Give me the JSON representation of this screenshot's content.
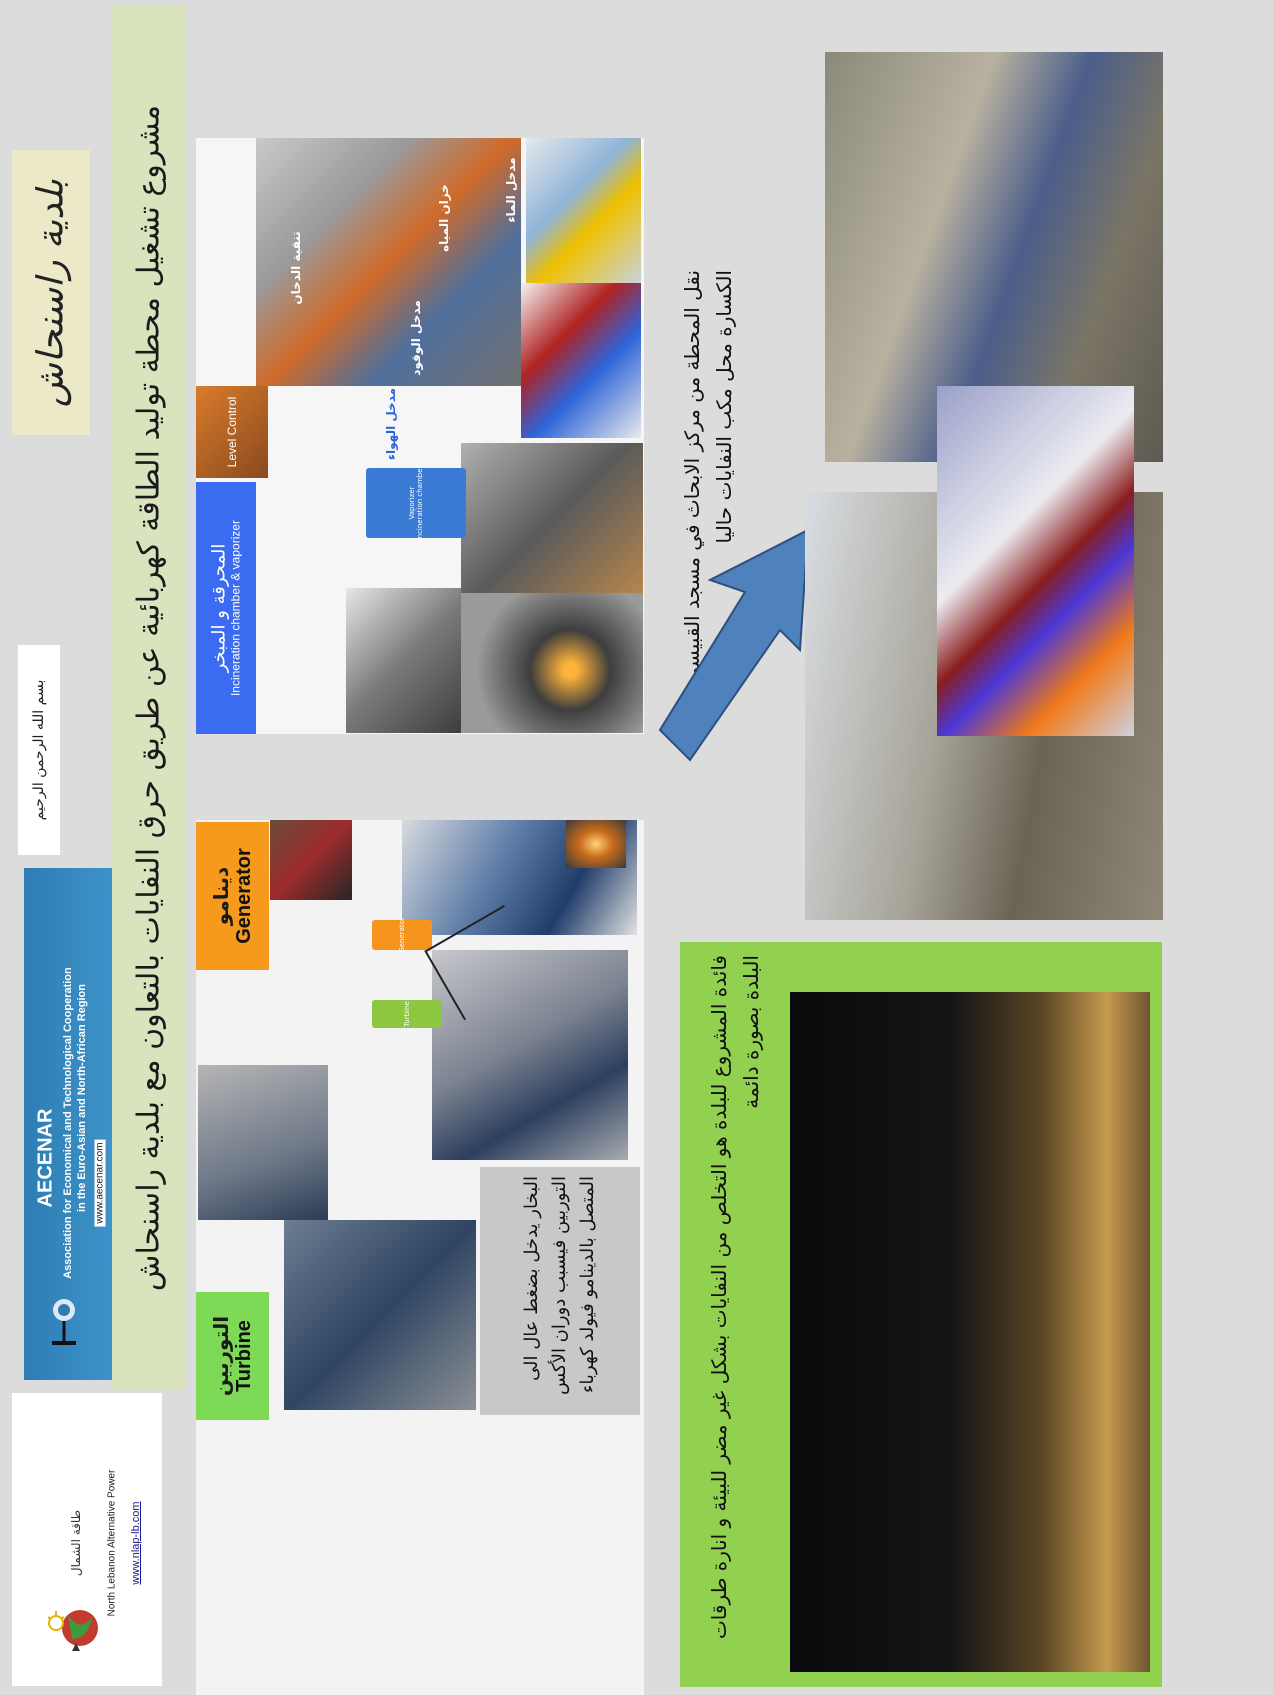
{
  "municipality": "بلدية راسنحاش",
  "title": "مشروع تشغيل محطة توليد الطاقة كهربائية عن طريق حرق النفايات بالتعاون مع بلدية راسنحاش",
  "basmala": "بسم الله الرحمن الرحيم",
  "nlap": {
    "arabic": "طاقة الشمال",
    "english": "North Lebanon Alternative Power",
    "url": "www.nlap-lb.com"
  },
  "aecenar": {
    "name": "AECENAR",
    "line1": "Association for Economical and Technological Cooperation",
    "line2": "in the Euro-Asian and North-African Region",
    "url": "www.aecenar.com"
  },
  "turbine": {
    "label_ar": "التوربين",
    "label_en": "Turbine",
    "description": "البخار يدخل بضغط عال الى التوربين فيسبب دوران الأكس المتصل بالدينامو فيولد كهرباء"
  },
  "generator": {
    "label_ar": "دينامو",
    "label_en": "Generator"
  },
  "incinerator": {
    "label_ar": "المحرقة و المبخر",
    "label_en": "Incineration chamber & vaporizer"
  },
  "photo_labels": {
    "level_control": "Level Control",
    "chimney": "تنقية الدخان",
    "fuel": "مدخل الوقود",
    "air": "مدخل الهواء",
    "water": "مدخل الماء",
    "tank": "خزان المياه"
  },
  "diagram_labels": {
    "vaporizer": "Vaporizer",
    "chamber": "Incineration chamber",
    "turbine": "Turbine",
    "generator": "Generator"
  },
  "transfer": "نقل المحطة من مركز الابحاث في مسجد القبيسي الى الكسارة محل مكب النفايات حاليا",
  "benefit": "فائدة المشروع للبلدة هو التخلص من النفايات بشكل غير مضر للبيئة و انارة طرقات البلدة بصورة دائمة",
  "colors": {
    "background": "#dcdcdc",
    "title_band": "#d9e3bd",
    "green": "#7ed957",
    "orange": "#f59a1c",
    "blue": "#3a6bf0",
    "arrow": "#4f81bd",
    "aecenar_blue": "#2d7db3",
    "benefit_green": "#92d050"
  },
  "icons": [
    "nlap-logo",
    "aecenar-logo",
    "arrow-icon"
  ]
}
